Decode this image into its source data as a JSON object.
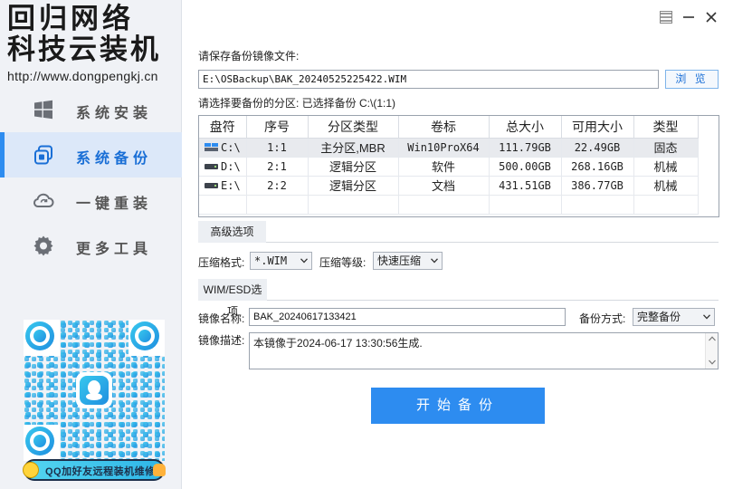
{
  "brand": {
    "line1": "回归网络",
    "line2": "科技云装机",
    "url": "http://www.dongpengkj.cn"
  },
  "sidebar": {
    "items": [
      {
        "label": "系统安装",
        "icon": "windows-icon",
        "active": false
      },
      {
        "label": "系统备份",
        "icon": "backup-copy-icon",
        "active": true
      },
      {
        "label": "一键重装",
        "icon": "cloud-refresh-icon",
        "active": false
      },
      {
        "label": "更多工具",
        "icon": "gear-icon",
        "active": false
      }
    ],
    "qq_banner": "QQ加好友远程装机维修"
  },
  "window_controls": [
    "restore-icon",
    "minimize-icon",
    "close-icon"
  ],
  "save_file": {
    "label": "请保存备份镜像文件:",
    "path": "E:\\OSBackup\\BAK_20240525225422.WIM",
    "browse_label": "浏 览"
  },
  "partition": {
    "label": "请选择要备份的分区: 已选择备份 C:\\(1:1)",
    "columns": [
      "盘符",
      "序号",
      "分区类型",
      "卷标",
      "总大小",
      "可用大小",
      "类型"
    ],
    "rows": [
      {
        "drive": "C:\\",
        "index": "1:1",
        "ptype": "主分区,MBR",
        "volume": "Win10ProX64",
        "total": "111.79GB",
        "free": "22.49GB",
        "kind": "固态",
        "selected": true
      },
      {
        "drive": "D:\\",
        "index": "2:1",
        "ptype": "逻辑分区",
        "volume": "软件",
        "total": "500.00GB",
        "free": "268.16GB",
        "kind": "机械",
        "selected": false
      },
      {
        "drive": "E:\\",
        "index": "2:2",
        "ptype": "逻辑分区",
        "volume": "文档",
        "total": "431.51GB",
        "free": "386.77GB",
        "kind": "机械",
        "selected": false
      }
    ]
  },
  "advanced": {
    "title": "高级选项",
    "format_label": "压缩格式:",
    "format_value": "*.WIM",
    "level_label": "压缩等级:",
    "level_value": "快速压缩"
  },
  "wim": {
    "title": "WIM/ESD选项",
    "name_label": "镜像名称:",
    "name_value": "BAK_20240617133421",
    "mode_label": "备份方式:",
    "mode_value": "完整备份",
    "desc_label": "镜像描述:",
    "desc_value": "本镜像于2024-06-17 13:30:56生成."
  },
  "start_label": "开始备份",
  "colors": {
    "accent": "#2d8cf0",
    "sidebar_bg": "#f0f2f6",
    "active_bg": "#dce8f9"
  }
}
